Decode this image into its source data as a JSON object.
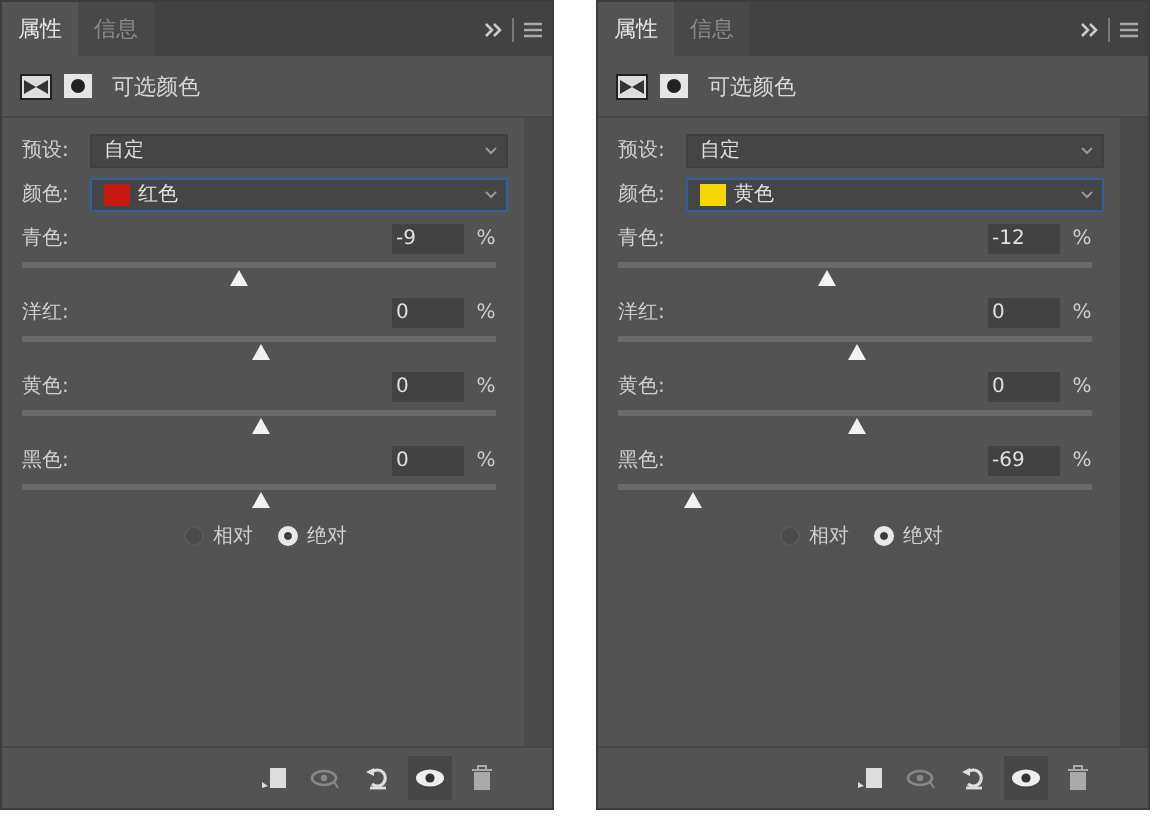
{
  "panels": [
    {
      "tabs": [
        {
          "label": "属性",
          "selected": true
        },
        {
          "label": "信息",
          "selected": false
        }
      ],
      "title": "可选颜色",
      "preset": {
        "label": "预设:",
        "value": "自定"
      },
      "color": {
        "label": "颜色:",
        "value": "红色",
        "color": "#c8190f"
      },
      "sliders": [
        {
          "label": "青色:",
          "value": "-9",
          "unit": "%",
          "level": 0.455
        },
        {
          "label": "洋红:",
          "value": "0",
          "unit": "%",
          "level": 0.5
        },
        {
          "label": "黄色:",
          "value": "0",
          "unit": "%",
          "level": 0.5
        },
        {
          "label": "黑色:",
          "value": "0",
          "unit": "%",
          "level": 0.5
        }
      ],
      "modes": [
        {
          "label": "相对",
          "selected": false
        },
        {
          "label": "绝对",
          "selected": true
        }
      ]
    },
    {
      "tabs": [
        {
          "label": "属性",
          "selected": true
        },
        {
          "label": "信息",
          "selected": false
        }
      ],
      "title": "可选颜色",
      "preset": {
        "label": "预设:",
        "value": "自定"
      },
      "color": {
        "label": "颜色:",
        "value": "黄色",
        "color": "#f5d800"
      },
      "sliders": [
        {
          "label": "青色:",
          "value": "-12",
          "unit": "%",
          "level": 0.44
        },
        {
          "label": "洋红:",
          "value": "0",
          "unit": "%",
          "level": 0.5
        },
        {
          "label": "黄色:",
          "value": "0",
          "unit": "%",
          "level": 0.5
        },
        {
          "label": "黑色:",
          "value": "-69",
          "unit": "%",
          "level": 0.155
        }
      ],
      "modes": [
        {
          "label": "相对",
          "selected": false
        },
        {
          "label": "绝对",
          "selected": true
        }
      ]
    }
  ]
}
